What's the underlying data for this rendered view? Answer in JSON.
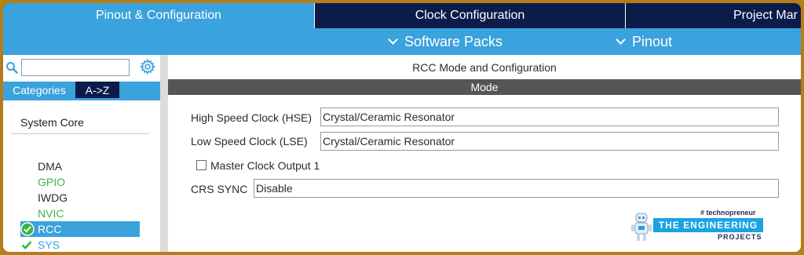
{
  "top_tabs": {
    "pinout_config": "Pinout & Configuration",
    "clock_config": "Clock Configuration",
    "project_manager": "Project Mar"
  },
  "sub_bar": {
    "software_packs": "Software Packs",
    "pinout": "Pinout"
  },
  "sidebar": {
    "search": {
      "value": "",
      "placeholder": ""
    },
    "tabs": {
      "categories": "Categories",
      "atoz": "A->Z"
    },
    "group": "System Core",
    "items": [
      {
        "label": "DMA",
        "status": "none"
      },
      {
        "label": "GPIO",
        "status": "configured"
      },
      {
        "label": "IWDG",
        "status": "none"
      },
      {
        "label": "NVIC",
        "status": "configured"
      },
      {
        "label": "RCC",
        "status": "selected-ok"
      },
      {
        "label": "SYS",
        "status": "ok"
      }
    ]
  },
  "main": {
    "title": "RCC Mode and Configuration",
    "section": "Mode",
    "hse": {
      "label": "High Speed Clock (HSE)",
      "value": "Crystal/Ceramic Resonator"
    },
    "lse": {
      "label": "Low Speed Clock (LSE)",
      "value": "Crystal/Ceramic Resonator"
    },
    "mco": {
      "label": "Master Clock Output 1",
      "checked": false
    },
    "crs": {
      "label": "CRS SYNC",
      "value": "Disable"
    }
  },
  "logo": {
    "tag": "# technopreneur",
    "name": "THE ENGINEERING",
    "sub": "PROJECTS"
  },
  "colors": {
    "accent_blue": "#3aa2dc",
    "navy": "#0b1b4a",
    "ok_green": "#3cb44b",
    "frame_gold": "#b47d1c"
  }
}
